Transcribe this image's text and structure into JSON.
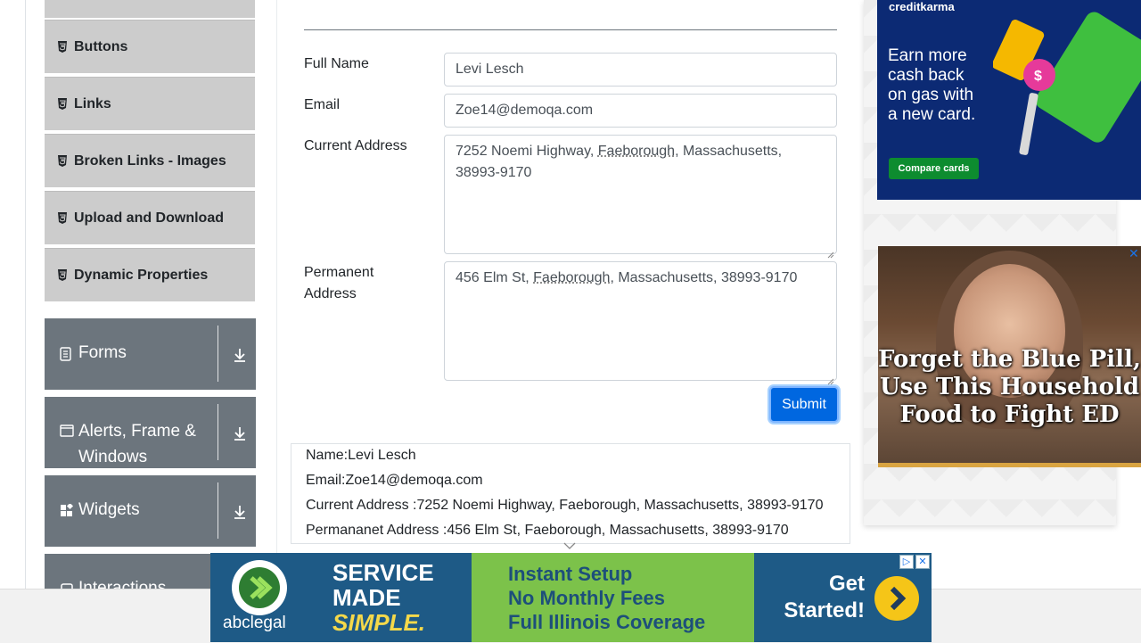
{
  "sidebar": {
    "elements_items": [
      {
        "label": "Buttons"
      },
      {
        "label": "Links"
      },
      {
        "label": "Broken Links - Images"
      },
      {
        "label": "Upload and Download"
      },
      {
        "label": "Dynamic Properties"
      }
    ],
    "groups": [
      {
        "label": "Forms",
        "icon": "document-icon"
      },
      {
        "label": "Alerts, Frame & Windows",
        "icon": "window-icon"
      },
      {
        "label": "Widgets",
        "icon": "widgets-icon"
      },
      {
        "label": "Interactions",
        "icon": "interactions-icon"
      }
    ]
  },
  "form": {
    "full_name": {
      "label": "Full Name",
      "value": "Levi Lesch"
    },
    "email": {
      "label": "Email",
      "value": "Zoe14@demoqa.com"
    },
    "current_address": {
      "label": "Current Address",
      "value_prefix": "7252 Noemi Highway, ",
      "value_underlined": "Faeborough",
      "value_suffix": ", Massachusetts,",
      "value_line2": "38993-9170"
    },
    "permanent_address": {
      "label_line1": "Permanent",
      "label_line2": "Address",
      "value_prefix": "456 Elm St, ",
      "value_underlined": "Faeborough",
      "value_suffix": ", Massachusetts, 38993-9170"
    },
    "submit_label": "Submit"
  },
  "output": {
    "name": "Name:Levi Lesch",
    "email": "Email:Zoe14@demoqa.com",
    "current_address": "Current Address :7252 Noemi Highway, Faeborough, Massachusetts, 38993-9170",
    "permanent_address": "Permananet Address :456 Elm St, Faeborough, Massachusetts, 38993-9170"
  },
  "ads": {
    "creditkarma": {
      "brand": "creditkarma",
      "headline": "Earn more cash back on gas with a new card.",
      "cta": "Compare cards",
      "bg_color": "#0c2a74",
      "cta_color": "#0d8c2f"
    },
    "health": {
      "caption": "Forget the Blue Pill, Use This Household Food to Fight ED",
      "close": "✕"
    },
    "banner": {
      "brand": "abclegal",
      "service_line1": "SERVICE",
      "service_line2": "MADE",
      "service_line3": "SIMPLE.",
      "mid_line1": "Instant Setup",
      "mid_line2": "No Monthly Fees",
      "mid_line3": "Full Illinois Coverage",
      "cta_line1": "Get",
      "cta_line2": "Started!",
      "ctl_info": "▷",
      "ctl_close": "✕"
    }
  }
}
